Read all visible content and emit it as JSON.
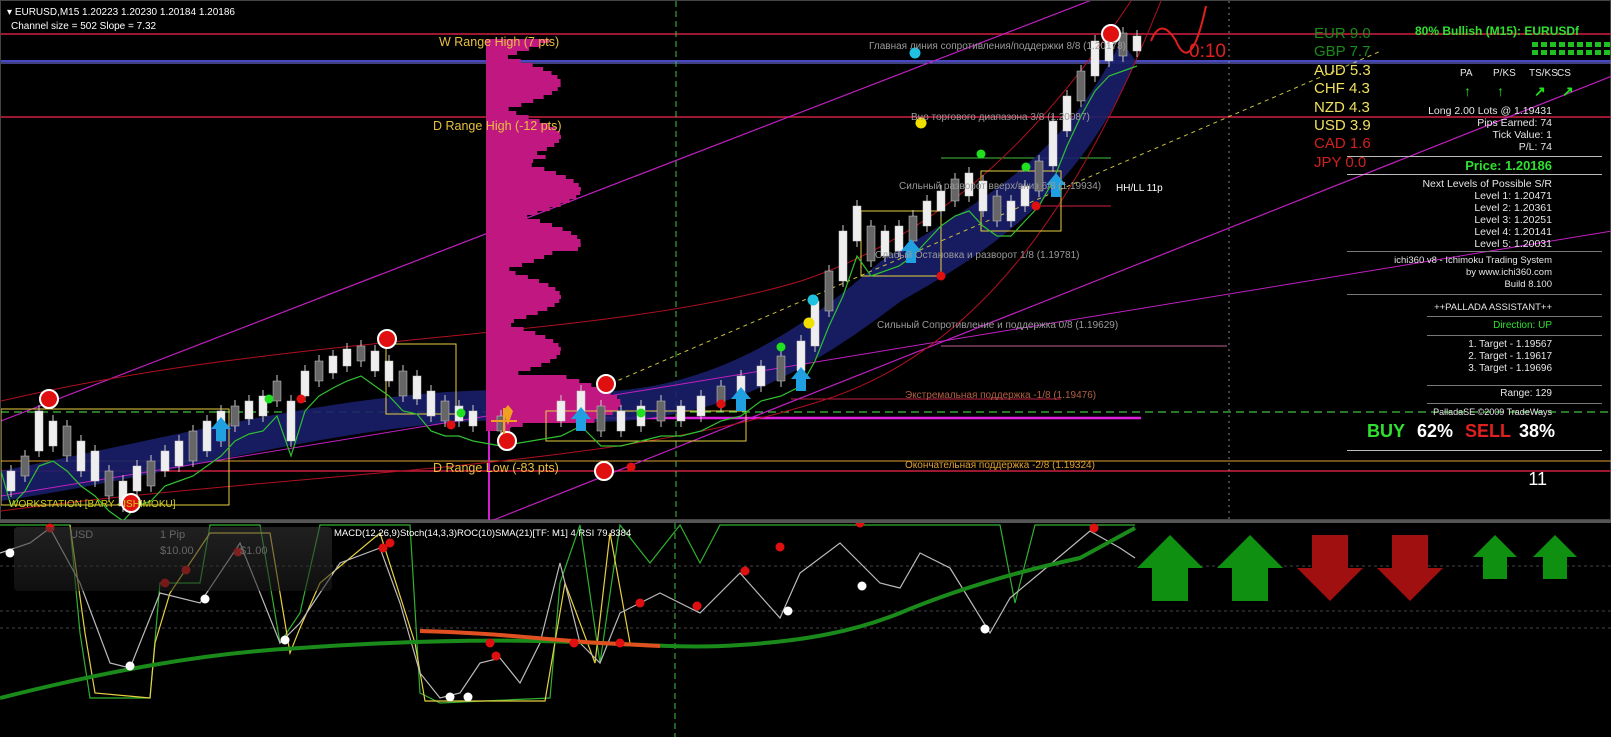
{
  "header": {
    "symbol_line": "EURUSD,M15  1.20223 1.20230 1.20184 1.20186",
    "channel_line": "Channel size = 502 Slope = 7.32",
    "workstation": "WORKSTATION [BARY - ISHIMOKU]",
    "marker_1": "1"
  },
  "range_labels": {
    "w_high": "W Range High (7 pts)",
    "d_high": "D Range High (-12 pts)",
    "d_low": "D Range Low (-83 pts)"
  },
  "murrey": {
    "main_resist": "Главная линия сопротивления/поддержки 8/8 (1.20178)",
    "top_range": "Вно торгового диапазона 3/8 (1.20087)",
    "strong_rev": "Сильный разворот вверх/вниз 6/8 (1.19934)",
    "weak_stop": "Слабый Остановка и разворот 1/8 (1.19781)",
    "strong_sr": "Сильный Сопротивление и поддержка 0/8 (1.19629)",
    "extreme": "Экстремальная поддержка -1/8 (1.19476)",
    "final": "Окончательная поддержка -2/8 (1.19324)",
    "hhll": "HH/LL 11p",
    "timer": "0:10"
  },
  "currencies": [
    {
      "name": "EUR",
      "value": "9.0",
      "color": "#1a8a1a"
    },
    {
      "name": "GBP",
      "value": "7.7",
      "color": "#1a8a1a"
    },
    {
      "name": "AUD",
      "value": "5.3",
      "color": "#f0e060"
    },
    {
      "name": "CHF",
      "value": "4.3",
      "color": "#f0e060"
    },
    {
      "name": "NZD",
      "value": "4.3",
      "color": "#f0e060"
    },
    {
      "name": "USD",
      "value": "3.9",
      "color": "#f0e060"
    },
    {
      "name": "CAD",
      "value": "1.6",
      "color": "#d02020"
    },
    {
      "name": "JPY",
      "value": "0.0",
      "color": "#d02020"
    }
  ],
  "panel": {
    "bullish": "80% Bullish (M15): EURUSDf",
    "cols": [
      "PA",
      "P/KS",
      "TS/KS",
      "CS"
    ],
    "trade": "Long 2.00 Lots @ 1.19431",
    "pips": "Pips Earned: 74",
    "tick": "Tick Value: 1",
    "pl": "P/L: 74",
    "price": "Price: 1.20186",
    "next_levels": "Next Levels of Possible S/R",
    "levels": [
      "Level 1: 1.20471",
      "Level 2: 1.20361",
      "Level 3: 1.20251",
      "Level 4: 1.20141",
      "Level 5: 1.20031"
    ],
    "ichi1": "ichi360 v8 - Ichimoku Trading System",
    "ichi2": "by www.ichi360.com",
    "ichi3": "Build 8.100",
    "palladа": "++PALLADA ASSISTANT++",
    "direction": "Direction: UP",
    "targets": [
      "1. Target - 1.19567",
      "2. Target - 1.19617",
      "3. Target - 1.19696"
    ],
    "range": "Range: 129",
    "copyright": "PalladaSE ©2009 TradeWays",
    "buy_label": "BUY",
    "buy_pct": "62%",
    "sell_label": "SELL",
    "sell_pct": "38%",
    "count": "11"
  },
  "sub": {
    "indicators": "MACD(12,26,9)Stoch(14,3,3)ROC(10)SMA(21)[TF: M1] 4  RSI 79.8384",
    "ghost_pips": "1 Pip",
    "ghost_usd": "USD",
    "ghost_v1": "$10.00",
    "ghost_v2": "$1.00",
    "arrows": [
      "up",
      "up",
      "down",
      "down",
      "up-small",
      "up-small"
    ]
  },
  "colors": {
    "bull": "#1a8a1a",
    "bear": "#cc1010",
    "magenta": "#c01880",
    "yellow": "#e8d040"
  }
}
